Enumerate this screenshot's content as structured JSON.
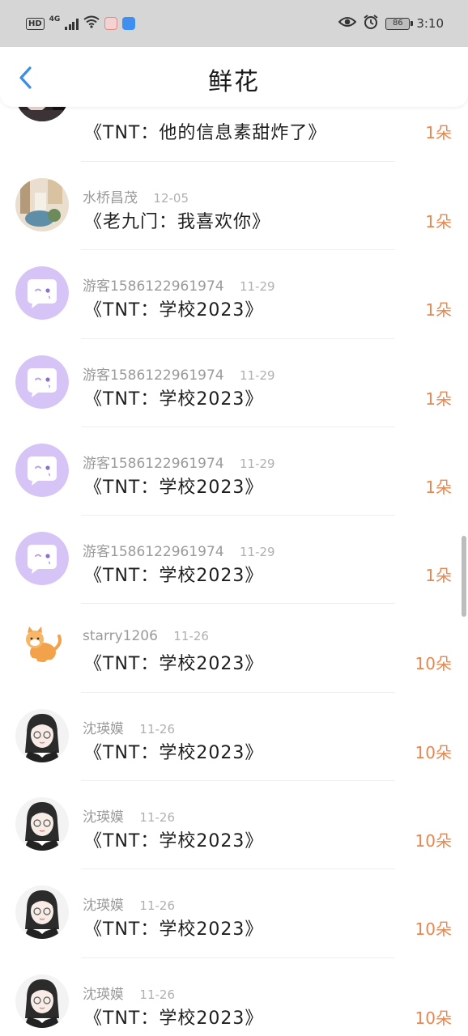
{
  "status_bar": {
    "hd": "HD",
    "network": "4G",
    "battery": "86",
    "time": "3:10"
  },
  "header": {
    "title": "鲜花"
  },
  "colors": {
    "accent_back": "#3a8ee6",
    "amount": "#e8874f",
    "guest_avatar": "#d5c4f5"
  },
  "list": {
    "items": [
      {
        "avatar": "photo-girl-dark",
        "user": "",
        "date": "",
        "book": "《TNT：他的信息素甜炸了》",
        "amount": "1朵"
      },
      {
        "avatar": "photo-room",
        "user": "水桥昌茂",
        "date": "12-05",
        "book": "《老九门：我喜欢你》",
        "amount": "1朵"
      },
      {
        "avatar": "guest-chat-icon",
        "user": "游客1586122961974",
        "date": "11-29",
        "book": "《TNT：学校2023》",
        "amount": "1朵"
      },
      {
        "avatar": "guest-chat-icon",
        "user": "游客1586122961974",
        "date": "11-29",
        "book": "《TNT：学校2023》",
        "amount": "1朵"
      },
      {
        "avatar": "guest-chat-icon",
        "user": "游客1586122961974",
        "date": "11-29",
        "book": "《TNT：学校2023》",
        "amount": "1朵"
      },
      {
        "avatar": "guest-chat-icon",
        "user": "游客1586122961974",
        "date": "11-29",
        "book": "《TNT：学校2023》",
        "amount": "1朵"
      },
      {
        "avatar": "cartoon-cat",
        "user": "starry1206",
        "date": "11-26",
        "book": "《TNT：学校2023》",
        "amount": "10朵"
      },
      {
        "avatar": "anime-girl-glasses",
        "user": "沈瑛嫫",
        "date": "11-26",
        "book": "《TNT：学校2023》",
        "amount": "10朵"
      },
      {
        "avatar": "anime-girl-glasses",
        "user": "沈瑛嫫",
        "date": "11-26",
        "book": "《TNT：学校2023》",
        "amount": "10朵"
      },
      {
        "avatar": "anime-girl-glasses",
        "user": "沈瑛嫫",
        "date": "11-26",
        "book": "《TNT：学校2023》",
        "amount": "10朵"
      },
      {
        "avatar": "anime-girl-glasses",
        "user": "沈瑛嫫",
        "date": "11-26",
        "book": "《TNT：学校2023》",
        "amount": "10朵"
      }
    ]
  }
}
